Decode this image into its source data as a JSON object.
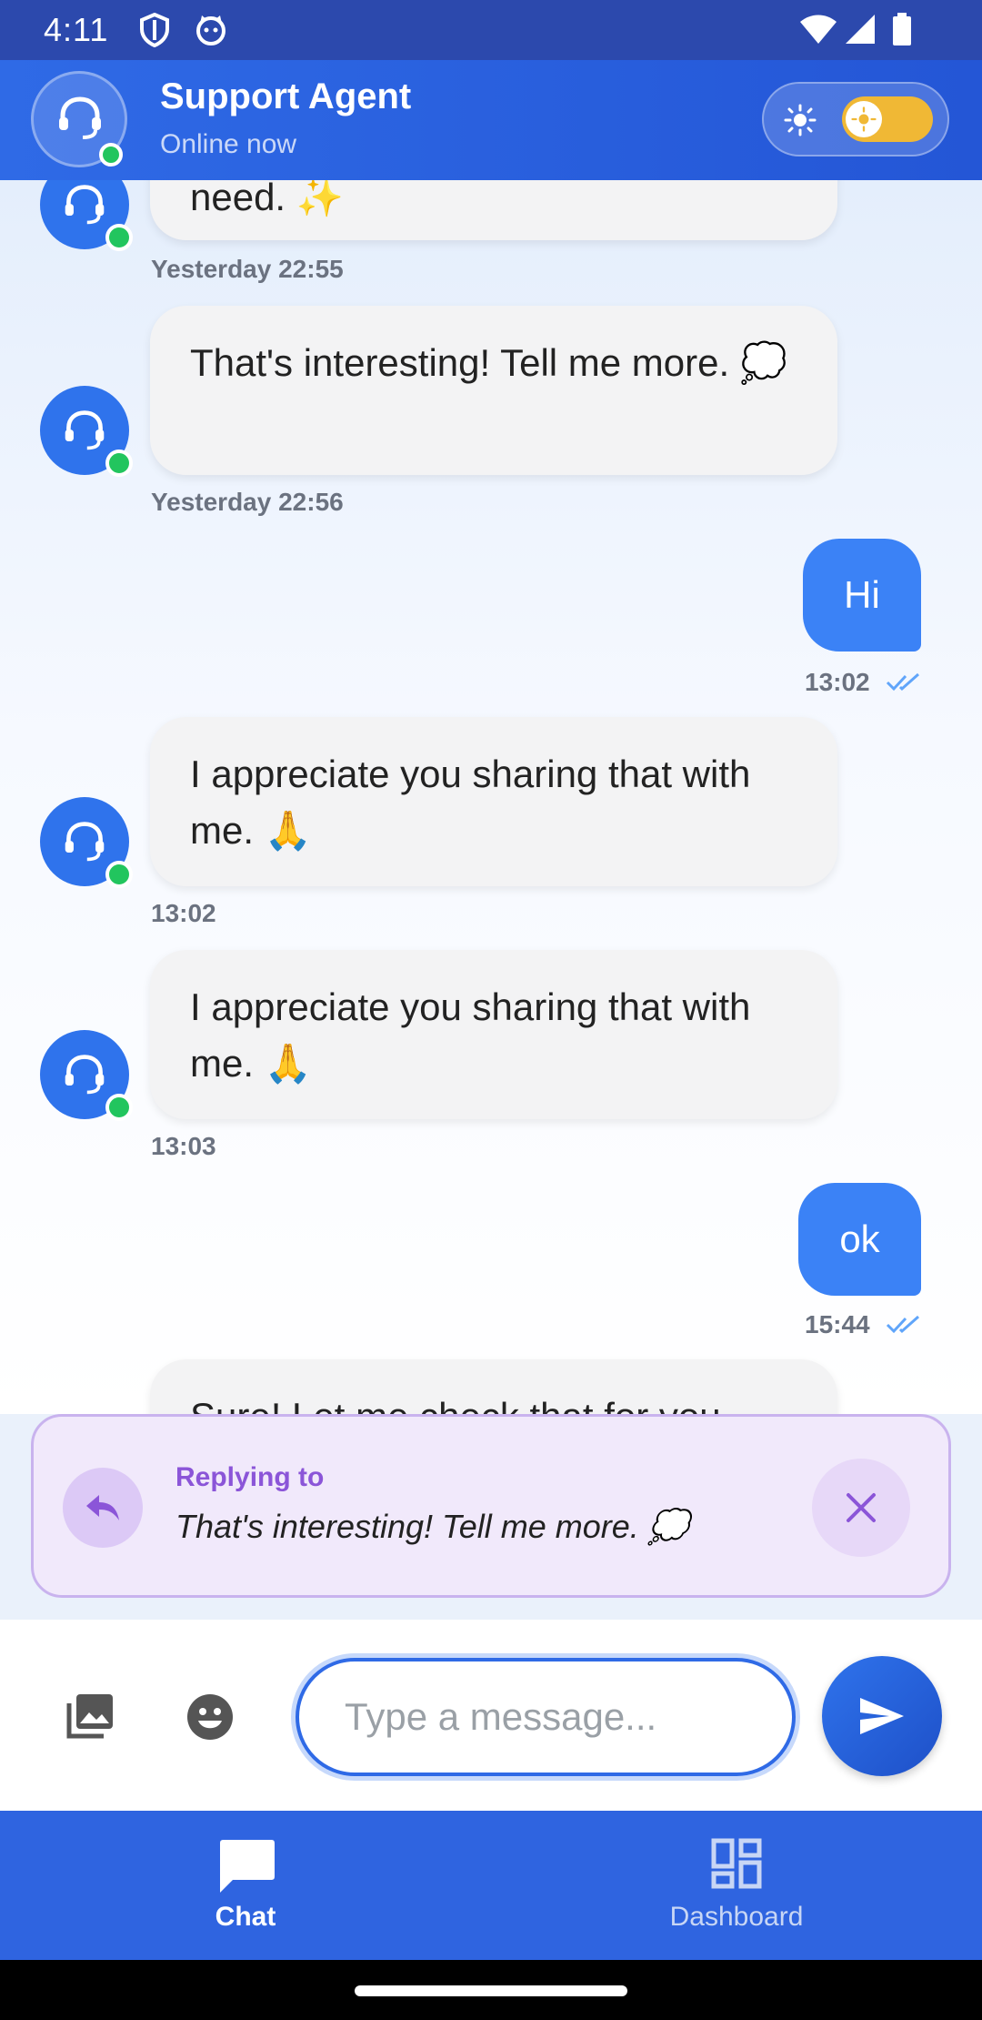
{
  "status_bar": {
    "time": "4:11"
  },
  "header": {
    "title": "Support Agent",
    "subtitle": "Online now"
  },
  "messages": [
    {
      "text": "need. ✨",
      "time": "Yesterday 22:55"
    },
    {
      "text": "That's interesting! Tell me more. 💭",
      "time": "Yesterday 22:56"
    },
    {
      "text": "Hi",
      "time": "13:02"
    },
    {
      "text": "I appreciate you sharing that with me. 🙏",
      "time": "13:02"
    },
    {
      "text": "I appreciate you sharing that with me. 🙏",
      "time": "13:03"
    },
    {
      "text": "ok",
      "time": "15:44"
    },
    {
      "text": "Sure! Let me check that for you."
    }
  ],
  "reply": {
    "label": "Replying to",
    "quote": "That's interesting! Tell me more. 💭"
  },
  "input": {
    "placeholder": "Type a message..."
  },
  "nav": {
    "chat": "Chat",
    "dashboard": "Dashboard"
  },
  "colors": {
    "primary": "#2f6ae6",
    "online": "#22c55e",
    "reply_accent": "#8b55d8",
    "outgoing_bubble": "#3b82f6"
  },
  "icons": [
    "support-agent-icon",
    "sun-icon",
    "reply-icon",
    "close-icon",
    "image-icon",
    "emoji-icon",
    "send-icon",
    "chat-icon",
    "dashboard-icon",
    "double-check-icon"
  ]
}
